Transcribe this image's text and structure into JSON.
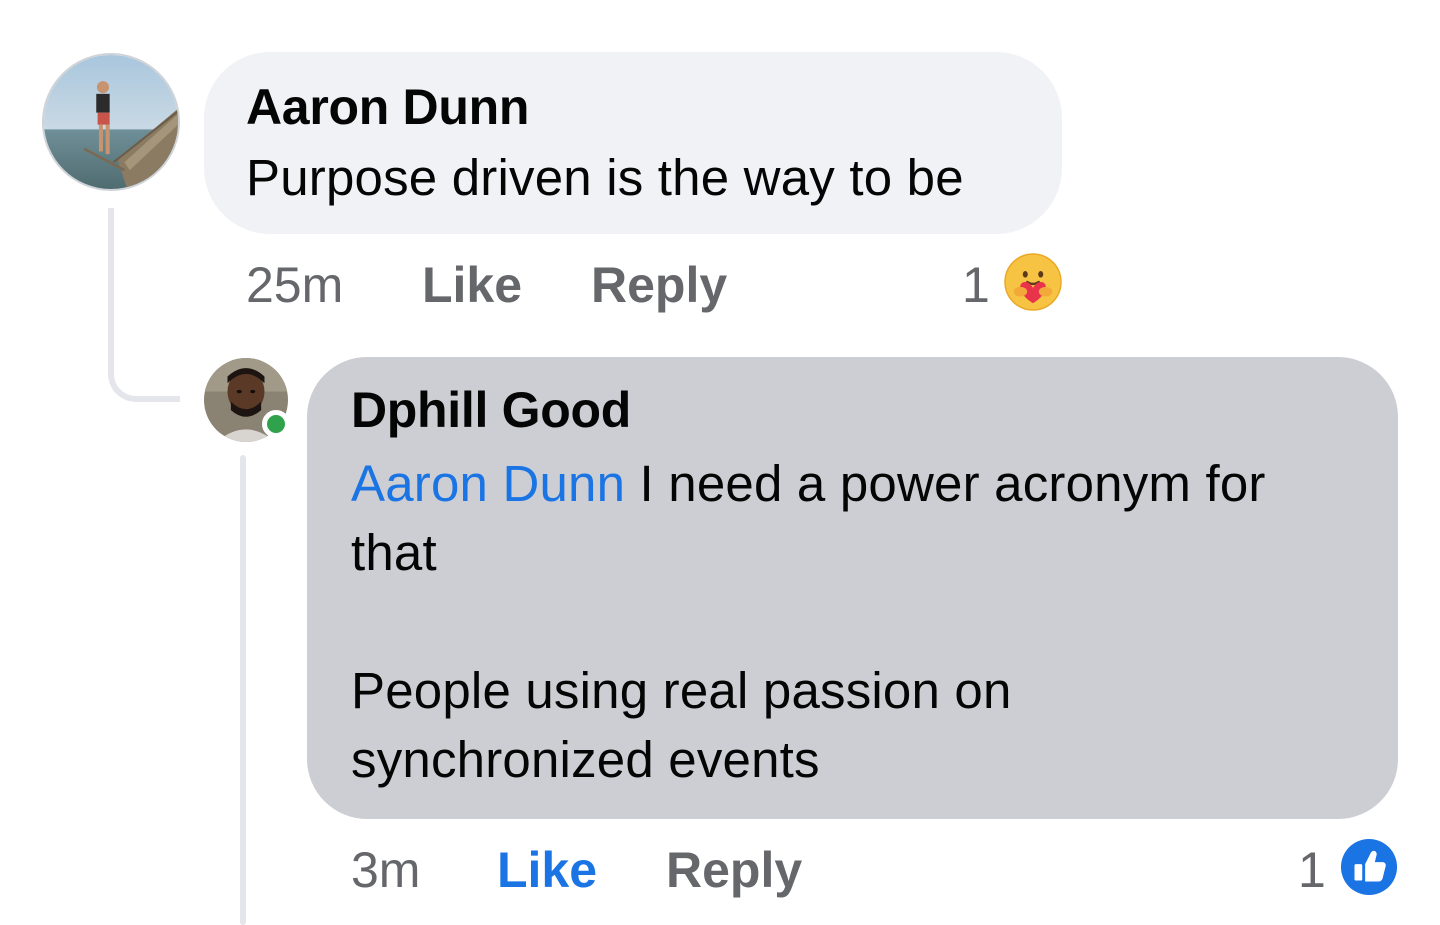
{
  "comments": [
    {
      "author": "Aaron Dunn",
      "text": "Purpose driven is the way to be",
      "time": "25m",
      "like_label": "Like",
      "reply_label": "Reply",
      "reaction_count": "1",
      "reaction_icon": "care-icon",
      "liked": false
    },
    {
      "author": "Dphill Good",
      "mention": "Aaron Dunn",
      "text_line1_rest": " I need a power acronym for",
      "text_line2": "that",
      "text_line3": "People using real passion on",
      "text_line4": "synchronized events",
      "time": "3m",
      "like_label": "Like",
      "reply_label": "Reply",
      "reaction_count": "1",
      "reaction_icon": "like-icon",
      "liked": true,
      "online": true
    }
  ],
  "colors": {
    "bubble_primary": "#f0f2f5",
    "bubble_highlighted": "#ccced3",
    "mention": "#1b74e4",
    "meta_text": "#65676b",
    "online": "#31a24c",
    "thread_line": "#e4e6eb"
  }
}
